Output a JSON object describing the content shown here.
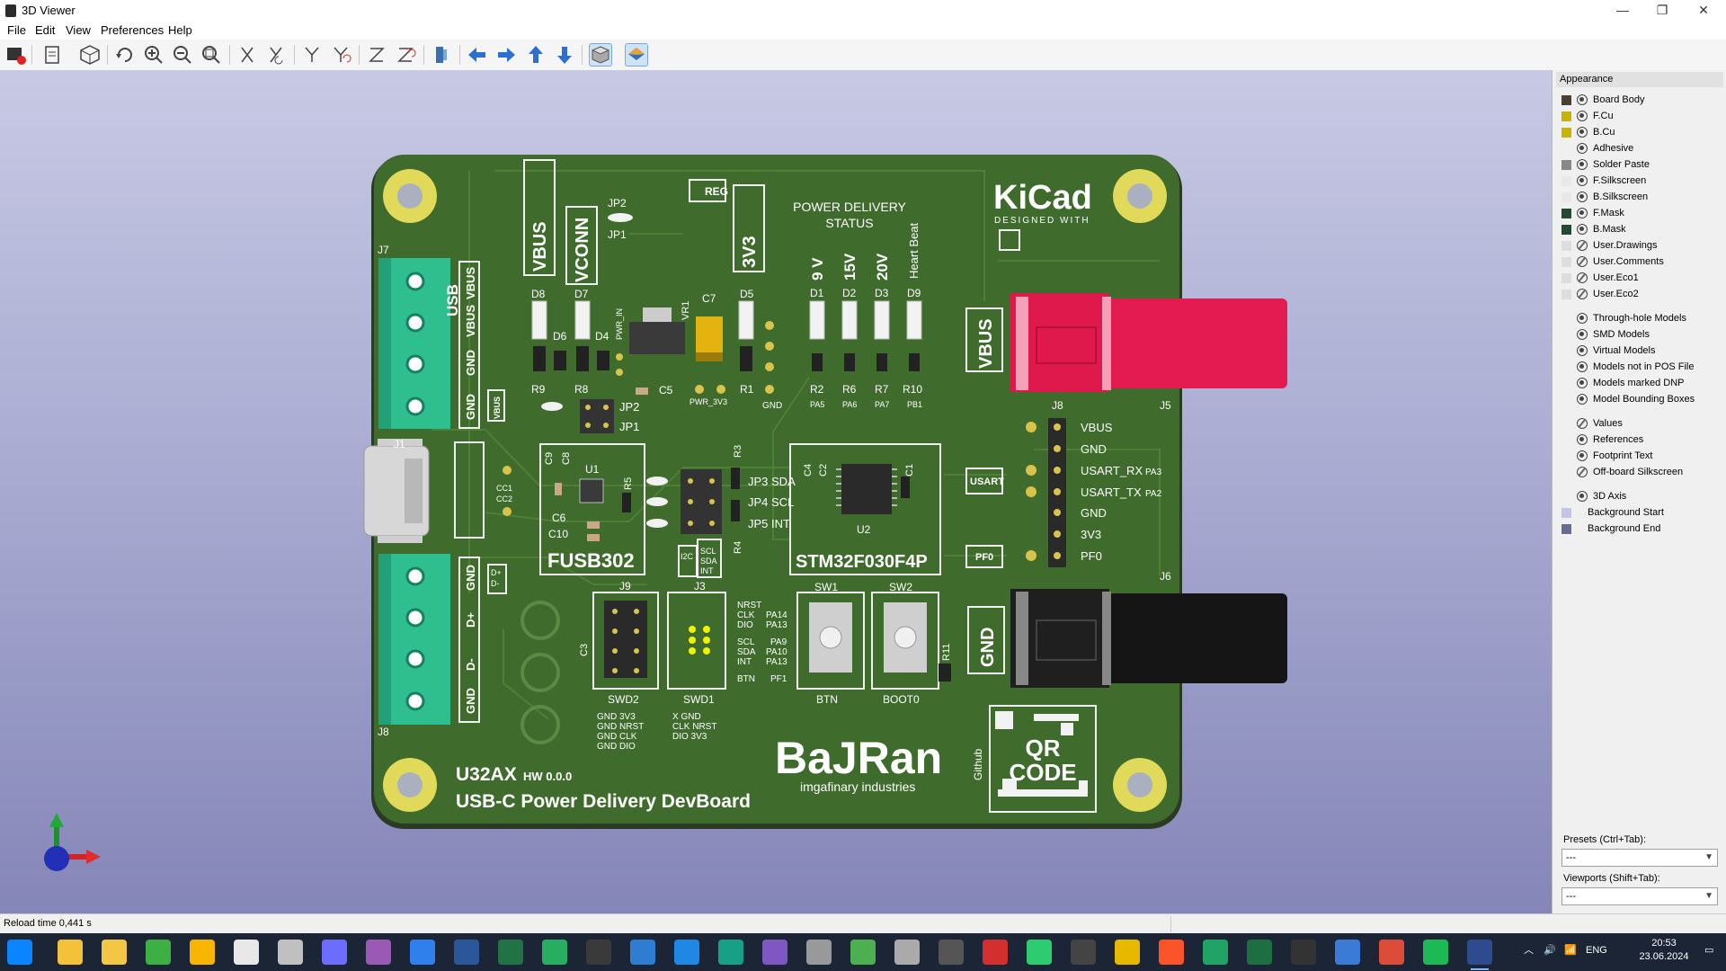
{
  "window": {
    "title": "3D Viewer",
    "minimize": "—",
    "restore": "❐",
    "close": "✕"
  },
  "menu": [
    "File",
    "Edit",
    "View",
    "Preferences",
    "Help"
  ],
  "toolbar": {
    "icons": [
      "render-raytrace-icon",
      "copy-image-icon",
      "reload-board-icon",
      "redraw-icon",
      "zoom-in-icon",
      "zoom-out-icon",
      "zoom-fit-icon",
      "rotate-x-cw-icon",
      "rotate-x-ccw-icon",
      "rotate-y-cw-icon",
      "rotate-y-ccw-icon",
      "rotate-z-cw-icon",
      "rotate-z-ccw-icon",
      "flip-board-icon",
      "pan-left-icon",
      "pan-right-icon",
      "pan-up-icon",
      "pan-down-icon",
      "orthographic-icon",
      "layers-manager-icon"
    ]
  },
  "board": {
    "title_line1": "U32AX",
    "hw": "HW 0.0.0",
    "title_line2": "USB-C Power Delivery DevBoard",
    "brand": "BaJRan",
    "brand_sub": "imgafinary industries",
    "kicad": "KiCad",
    "kicad_sub": "DESIGNED WITH",
    "pd_status_1": "POWER DELIVERY",
    "pd_status_2": "STATUS",
    "usb": "USB",
    "vbus": "VBUS",
    "vconn": "VCONN",
    "v3v3": "3V3",
    "reg": "REG",
    "gnd": "GND",
    "fusb": "FUSB302",
    "stm": "STM32F030F4P",
    "usart": "USART",
    "pf0": "PF0",
    "qr1": "QR",
    "qr2": "CODE",
    "github": "Github",
    "v9": "9 V",
    "v15": "15V",
    "v20": "20V",
    "heartbeat": "Heart Beat",
    "leds": [
      "D1",
      "D2",
      "D3",
      "D9"
    ],
    "led_res": [
      "R2",
      "R6",
      "R7",
      "R10"
    ],
    "led_pins": [
      "PA5",
      "PA6",
      "PA7",
      "PB1"
    ],
    "j8_pins": [
      "VBUS",
      "GND",
      "USART_RX",
      "USART_TX",
      "GND",
      "3V3",
      "PF0"
    ],
    "j8_pin_suffix": [
      "",
      "",
      "PA3",
      "PA2",
      "",
      "",
      ""
    ],
    "jp_labels": [
      "JP3 SDA",
      "JP4 SCL",
      "JP5 INT"
    ],
    "refs": {
      "j7": "J7",
      "j8a": "J8",
      "j8b": "J8",
      "j1": "J1",
      "j5": "J5",
      "j6": "J6",
      "j9": "J9",
      "j3": "J3",
      "d8": "D8",
      "d7": "D7",
      "d5": "D5",
      "d6": "D6",
      "d4": "D4",
      "r9": "R9",
      "r8": "R8",
      "r1": "R1",
      "c7": "C7",
      "vr1": "VR1",
      "c5": "C5",
      "jp2a": "JP2",
      "jp1a": "JP1",
      "jp2b": "JP2",
      "jp1b": "JP1",
      "u1": "U1",
      "u2": "U2",
      "c9": "C9",
      "c8": "C8",
      "c6": "C6",
      "c10": "C10",
      "r5": "R5",
      "r3": "R3",
      "r4": "R4",
      "c4": "C4",
      "c2": "C2",
      "c1": "C1",
      "c3": "C3",
      "sw1": "SW1",
      "sw2": "SW2",
      "r11": "R11",
      "swd2": "SWD2",
      "swd1": "SWD1",
      "btn": "BTN",
      "boot0": "BOOT0",
      "pwr_in": "PWR_IN",
      "pwr_3v3": "PWR_3V3",
      "cc1": "CC1",
      "cc2": "CC2",
      "i2c": "I2C",
      "scl": "SCL",
      "sda": "SDA",
      "int": "INT",
      "dplus": "D+",
      "dminus": "D-"
    },
    "j7_labels": [
      "VBUS",
      "VBUS",
      "GND",
      "GND"
    ],
    "j8_left_labels": [
      "GND",
      "D+",
      "D-",
      "GND"
    ],
    "swd2_pins": [
      "GND 3V3",
      "GND NRST",
      "GND CLK",
      "GND DIO"
    ],
    "swd1_pins": [
      "X GND",
      "CLK NRST",
      "DIO 3V3"
    ],
    "pin_table": [
      [
        "NRST",
        ""
      ],
      [
        "CLK",
        "PA14"
      ],
      [
        "DIO",
        "PA13"
      ],
      [
        "",
        ""
      ],
      [
        "SCL",
        "PA9"
      ],
      [
        "SDA",
        "PA10"
      ],
      [
        "INT",
        "PA13"
      ],
      [
        "",
        ""
      ],
      [
        "BTN",
        "PF1"
      ]
    ]
  },
  "appearance": {
    "header": "Appearance",
    "layers": [
      {
        "name": "Board Body",
        "color": "#4a4030",
        "vis": "on"
      },
      {
        "name": "F.Cu",
        "color": "#c8b400",
        "vis": "on"
      },
      {
        "name": "B.Cu",
        "color": "#c8b400",
        "vis": "on"
      },
      {
        "name": "Adhesive",
        "color": "",
        "vis": "on"
      },
      {
        "name": "Solder Paste",
        "color": "#888888",
        "vis": "on"
      },
      {
        "name": "F.Silkscreen",
        "color": "#e8e8e8",
        "vis": "on"
      },
      {
        "name": "B.Silkscreen",
        "color": "#e8e8e8",
        "vis": "on"
      },
      {
        "name": "F.Mask",
        "color": "#244a34",
        "vis": "on"
      },
      {
        "name": "B.Mask",
        "color": "#244a34",
        "vis": "on"
      },
      {
        "name": "User.Drawings",
        "color": "#dddddd",
        "vis": "off"
      },
      {
        "name": "User.Comments",
        "color": "#dddddd",
        "vis": "off"
      },
      {
        "name": "User.Eco1",
        "color": "#dddddd",
        "vis": "off"
      },
      {
        "name": "User.Eco2",
        "color": "#dddddd",
        "vis": "off"
      }
    ],
    "models": [
      {
        "name": "Through-hole Models",
        "vis": "on"
      },
      {
        "name": "SMD Models",
        "vis": "on"
      },
      {
        "name": "Virtual Models",
        "vis": "on"
      },
      {
        "name": "Models not in POS File",
        "vis": "on"
      },
      {
        "name": "Models marked DNP",
        "vis": "on"
      },
      {
        "name": "Model Bounding Boxes",
        "vis": "on"
      }
    ],
    "texts": [
      {
        "name": "Values",
        "vis": "off"
      },
      {
        "name": "References",
        "vis": "on"
      },
      {
        "name": "Footprint Text",
        "vis": "on"
      },
      {
        "name": "Off-board Silkscreen",
        "vis": "off"
      }
    ],
    "axis": {
      "name": "3D Axis",
      "vis": "on"
    },
    "background": [
      {
        "name": "Background Start",
        "color": "#c4c4e6"
      },
      {
        "name": "Background End",
        "color": "#6a6a98"
      }
    ],
    "presets_label": "Presets (Ctrl+Tab):",
    "presets_value": "---",
    "viewports_label": "Viewports (Shift+Tab):",
    "viewports_value": "---"
  },
  "status": {
    "text": "Reload time 0,441 s"
  },
  "taskbar": {
    "icons": [
      "start-icon",
      "file-explorer-icon",
      "notes-icon",
      "app-green-icon",
      "app-yellow-icon",
      "app-doc-icon",
      "calendar-icon",
      "app-grey-icon",
      "app-diamond-icon",
      "app-network-icon",
      "app-word-icon",
      "app-excel-icon",
      "app-green2-icon",
      "app-circle-icon",
      "app-prg-icon",
      "vscode-icon",
      "app-mx-icon",
      "app-hex-icon",
      "app-bird-icon",
      "app-tree-icon",
      "app-clip-icon",
      "app-cd-icon",
      "acrobat-icon",
      "app-sync-icon",
      "github-icon",
      "app-bolt-icon",
      "brave-icon",
      "app-green3-icon",
      "app-excel2-icon",
      "terminal-icon",
      "app-remote-icon",
      "chrome-icon",
      "app-u-icon",
      "kicad-icon"
    ],
    "lang": "ENG",
    "time": "20:53",
    "date": "23.06.2024"
  }
}
